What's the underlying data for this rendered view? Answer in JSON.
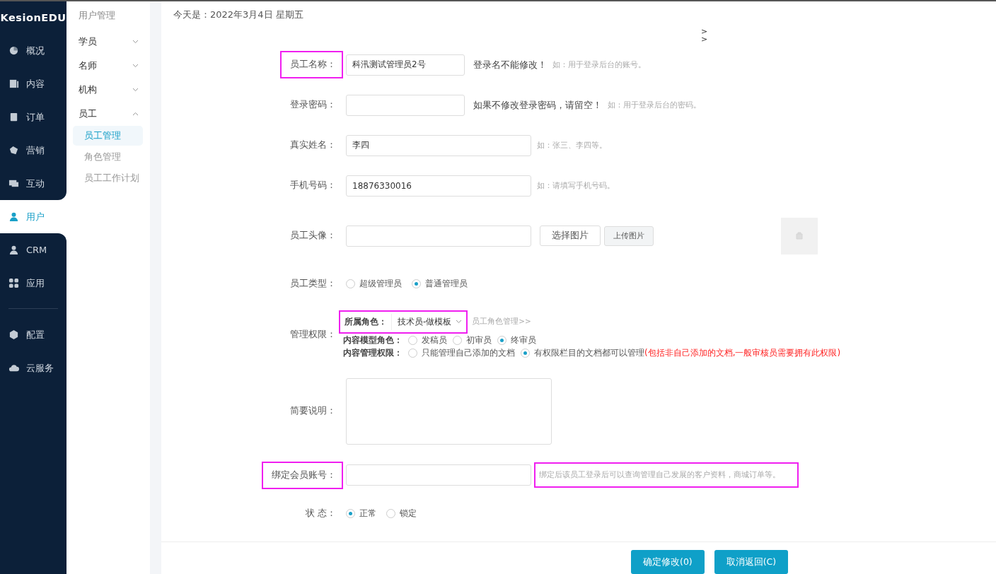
{
  "brand": "KesionEDU",
  "nav": [
    {
      "label": "概况",
      "selected": false
    },
    {
      "label": "内容",
      "selected": false
    },
    {
      "label": "订单",
      "selected": false
    },
    {
      "label": "营销",
      "selected": false
    },
    {
      "label": "互动",
      "selected": false
    },
    {
      "label": "用户",
      "selected": true
    },
    {
      "label": "CRM",
      "selected": false
    },
    {
      "label": "应用",
      "selected": false
    },
    {
      "kind": "divider"
    },
    {
      "label": "配置",
      "selected": false
    },
    {
      "label": "云服务",
      "selected": false
    }
  ],
  "subnav": {
    "title": "用户管理",
    "groups": [
      {
        "label": "学员",
        "expanded": false
      },
      {
        "label": "名师",
        "expanded": false
      },
      {
        "label": "机构",
        "expanded": false
      },
      {
        "label": "员工",
        "expanded": true,
        "children": [
          {
            "label": "员工管理",
            "selected": true
          },
          {
            "label": "角色管理",
            "selected": false
          },
          {
            "label": "员工工作计划",
            "selected": false
          }
        ]
      }
    ]
  },
  "date": "今天是：2022年3月4日 星期五",
  "arrows": [
    ">",
    ">"
  ],
  "form": [
    {
      "kind": "text",
      "label": "员工名称：",
      "highlighted": true,
      "value": "科汛测试管理员2号",
      "wide": false,
      "note": "登录名不能修改！",
      "hint": "如：用于登录后台的账号。"
    },
    {
      "kind": "text",
      "label": "登录密码：",
      "highlighted": false,
      "wide": false,
      "note": "如果不修改登录密码，请留空！",
      "hint": "如：用于登录后台的密码。"
    },
    {
      "kind": "text",
      "label": "真实姓名：",
      "highlighted": false,
      "value": "李四",
      "wide": true,
      "hint": "如：张三、李四等。"
    },
    {
      "kind": "text",
      "label": "手机号码：",
      "highlighted": false,
      "value": "18876330016",
      "wide": true,
      "hint": "如：请填写手机号码。"
    },
    {
      "kind": "upload",
      "label": "员工头像：",
      "highlighted": false,
      "buttons": [
        "选择图片",
        "上传图片"
      ]
    },
    {
      "kind": "radio",
      "label": "员工类型：",
      "highlighted": false,
      "options": [
        {
          "label": "超级管理员",
          "selected": false
        },
        {
          "label": "普通管理员",
          "selected": true
        }
      ]
    },
    {
      "kind": "permissions",
      "label": "管理权限：",
      "highlighted": false,
      "role": {
        "label": "所属角色：",
        "value": "技术员-做模板",
        "highlighted": true,
        "link": "员工角色管理>>"
      },
      "groups": [
        {
          "label": "内容模型角色：",
          "options": [
            {
              "label": "发稿员",
              "selected": false
            },
            {
              "label": "初审员",
              "selected": false
            },
            {
              "label": "终审员",
              "selected": true
            }
          ]
        },
        {
          "label": "内容管理权限：",
          "options": [
            {
              "label": "只能管理自己添加的文档",
              "selected": false
            },
            {
              "label": "有权限栏目的文档都可以管理",
              "selected": true
            }
          ],
          "warning": "(包括非自己添加的文档,一般审核员需要拥有此权限)"
        }
      ]
    },
    {
      "kind": "textarea",
      "label": "简要说明：",
      "highlighted": false
    },
    {
      "kind": "text",
      "label": "绑定会员账号：",
      "highlighted": true,
      "wide": true,
      "hint": "绑定后该员工登录后可以查询管理自己发展的客户资料，商城订单等。",
      "hint_highlighted": true
    },
    {
      "kind": "radio",
      "label": "状 态：",
      "highlighted": false,
      "options": [
        {
          "label": "正常",
          "selected": true
        },
        {
          "label": "锁定",
          "selected": false
        }
      ]
    }
  ],
  "buttons": [
    "确定修改(0)",
    "取消返回(C)"
  ]
}
